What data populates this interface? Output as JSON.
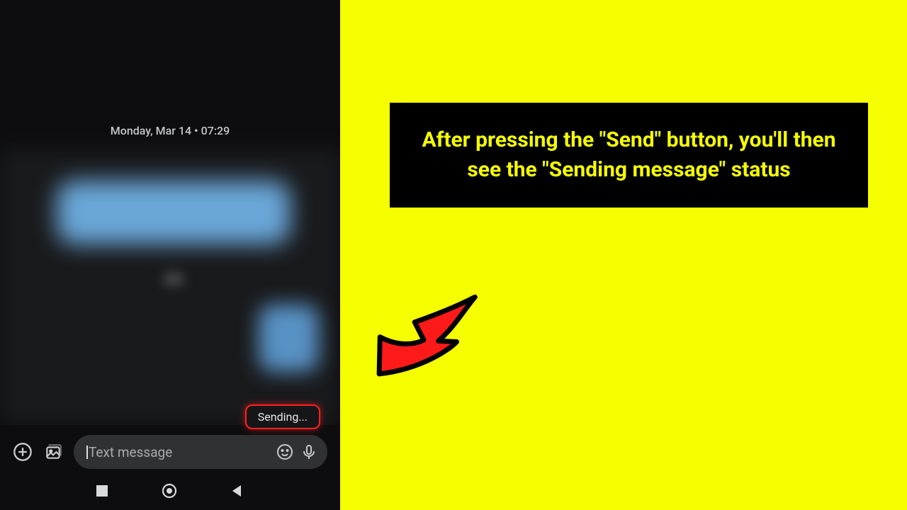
{
  "phone": {
    "datestamp": "Monday, Mar 14 • 07:29",
    "sending_status": "Sending...",
    "input_placeholder": "Text message"
  },
  "caption": "After pressing the \"Send\" button, you'll then see the \"Sending message\" status"
}
